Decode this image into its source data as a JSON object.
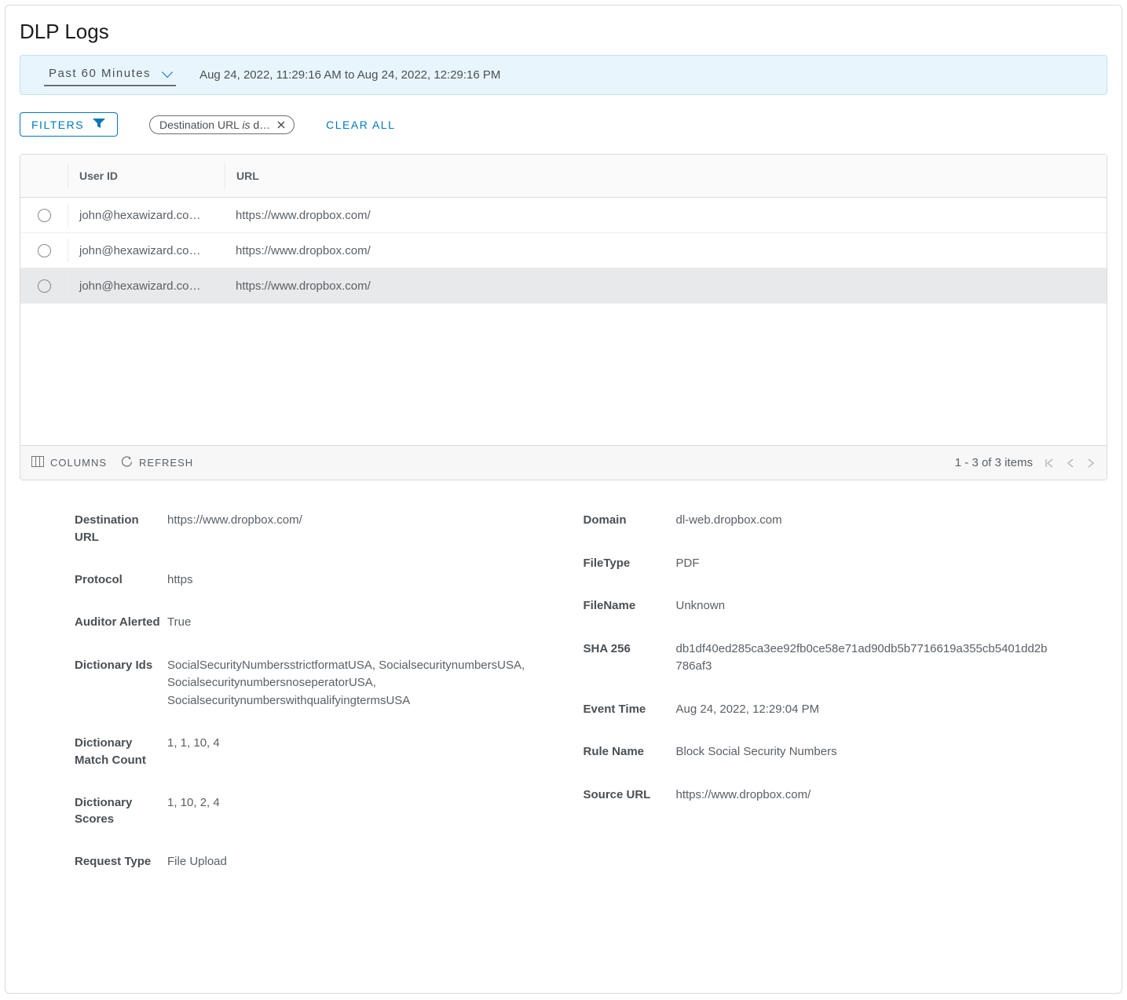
{
  "page": {
    "title": "DLP Logs"
  },
  "timerange": {
    "selected": "Past 60 Minutes",
    "range_text": "Aug 24, 2022, 11:29:16 AM to Aug 24, 2022, 12:29:16 PM"
  },
  "filters": {
    "button_label": "FILTERS",
    "chips": [
      {
        "field": "Destination URL",
        "verb": "is",
        "value": "d…"
      }
    ],
    "clear_all": "CLEAR ALL"
  },
  "table": {
    "columns": {
      "userid": "User ID",
      "url": "URL"
    },
    "rows": [
      {
        "userid": "john@hexawizard.co…",
        "url": "https://www.dropbox.com/",
        "selected": false
      },
      {
        "userid": "john@hexawizard.co…",
        "url": "https://www.dropbox.com/",
        "selected": false
      },
      {
        "userid": "john@hexawizard.co…",
        "url": "https://www.dropbox.com/",
        "selected": true
      }
    ],
    "footer": {
      "columns_label": "COLUMNS",
      "refresh_label": "REFRESH",
      "page_text": "1 - 3 of 3 items"
    }
  },
  "details": {
    "left": [
      {
        "label": "Destination URL",
        "value": "https://www.dropbox.com/"
      },
      {
        "label": "Protocol",
        "value": "https"
      },
      {
        "label": "Auditor Alerted",
        "value": "True"
      },
      {
        "label": "Dictionary Ids",
        "value": "SocialSecurityNumbersstrictformatUSA, SocialsecuritynumbersUSA, SocialsecuritynumbersnoseperatorUSA, SocialsecuritynumberswithqualifyingtermsUSA"
      },
      {
        "label": "Dictionary Match Count",
        "value": "1, 1, 10, 4"
      },
      {
        "label": "Dictionary Scores",
        "value": "1, 10, 2, 4"
      },
      {
        "label": "Request Type",
        "value": "File Upload"
      }
    ],
    "right": [
      {
        "label": "Domain",
        "value": "dl-web.dropbox.com"
      },
      {
        "label": "FileType",
        "value": "PDF"
      },
      {
        "label": "FileName",
        "value": "Unknown"
      },
      {
        "label": "SHA 256",
        "value": "db1df40ed285ca3ee92fb0ce58e71ad90db5b7716619a355cb5401dd2b786af3"
      },
      {
        "label": "Event Time",
        "value": "Aug 24, 2022, 12:29:04 PM"
      },
      {
        "label": "Rule Name",
        "value": "Block Social Security Numbers"
      },
      {
        "label": "Source URL",
        "value": "https://www.dropbox.com/"
      }
    ]
  }
}
